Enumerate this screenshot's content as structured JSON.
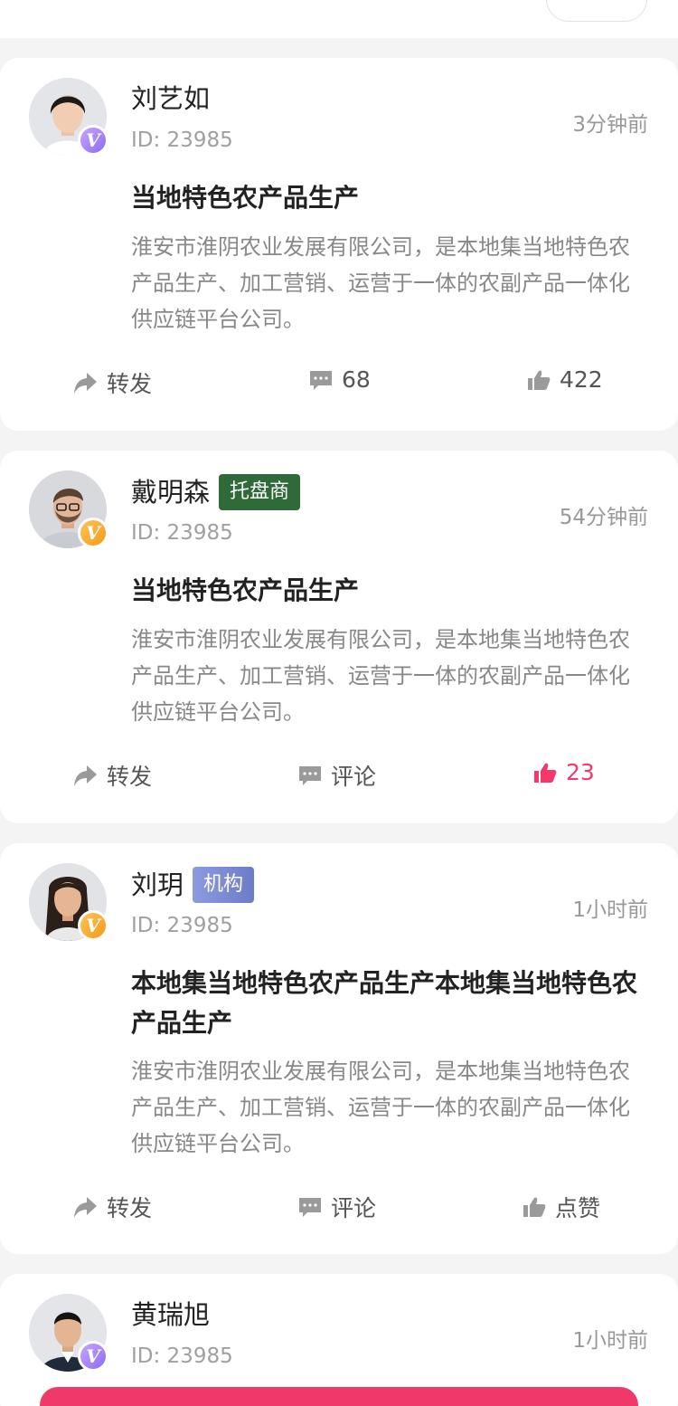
{
  "posts": [
    {
      "name": "刘艺如",
      "tag": "",
      "id": "ID: 23985",
      "time": "3分钟前",
      "title": "当地特色农产品生产",
      "body": "淮安市淮阴农业发展有限公司，是本地集当地特色农产品生产、加工营销、运营于一体的农副产品一体化供应链平台公司。",
      "share": "转发",
      "comment": "68",
      "like": "422",
      "liked": false,
      "badge_color": "purple",
      "verified": "V"
    },
    {
      "name": "戴明森",
      "tag": "托盘商",
      "id": "ID: 23985",
      "time": "54分钟前",
      "title": "当地特色农产品生产",
      "body": "淮安市淮阴农业发展有限公司，是本地集当地特色农产品生产、加工营销、运营于一体的农副产品一体化供应链平台公司。",
      "share": "转发",
      "comment": "评论",
      "like": "23",
      "liked": true,
      "badge_color": "orange",
      "verified": "V"
    },
    {
      "name": "刘玥",
      "tag": "机构",
      "id": "ID: 23985",
      "time": "1小时前",
      "title": "本地集当地特色农产品生产本地集当地特色农产品生产",
      "body": "淮安市淮阴农业发展有限公司，是本地集当地特色农产品生产、加工营销、运营于一体的农副产品一体化供应链平台公司。",
      "share": "转发",
      "comment": "评论",
      "like": "点赞",
      "liked": false,
      "badge_color": "orange",
      "verified": "V"
    },
    {
      "name": "黄瑞旭",
      "tag": "",
      "id": "ID: 23985",
      "time": "1小时前",
      "badge_color": "purple",
      "verified": "V"
    }
  ],
  "colors": {
    "accent": "#f5386a",
    "tag_green": "#2e6b38",
    "tag_blue": "#7b89d4"
  },
  "icons": {
    "share": "share-arrow-icon",
    "comment": "comment-bubble-icon",
    "like": "thumbs-up-icon"
  }
}
